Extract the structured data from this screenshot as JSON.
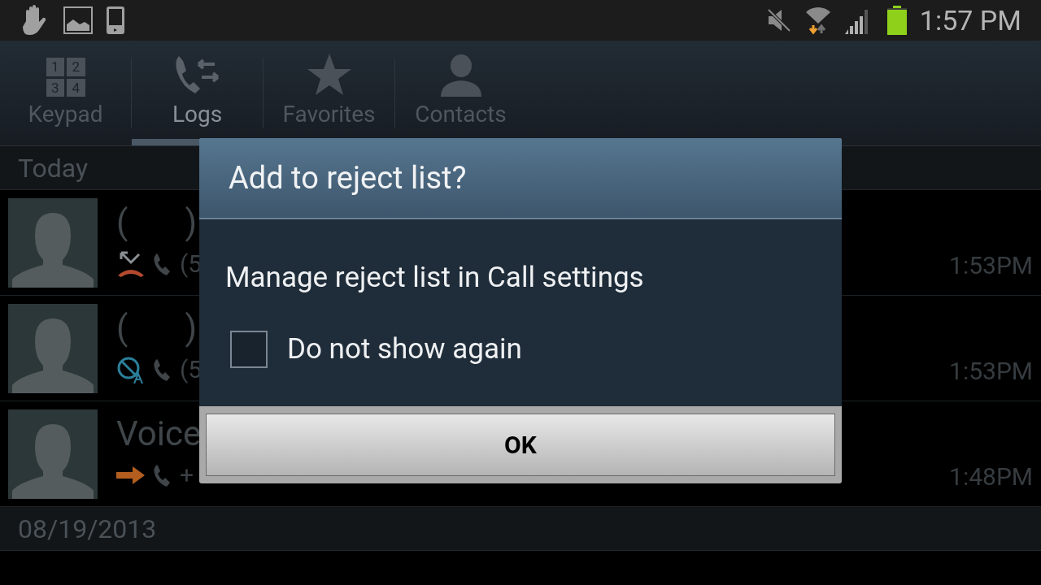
{
  "status_bar": {
    "time": "1:57 PM",
    "battery": {
      "level": 0.95
    }
  },
  "tabs": [
    {
      "label": "Keypad",
      "kind": "keypad",
      "selected": false,
      "keys": [
        "1",
        "2",
        "3",
        "4"
      ]
    },
    {
      "label": "Logs",
      "kind": "logs",
      "selected": true
    },
    {
      "label": "Favorites",
      "kind": "star",
      "selected": false
    },
    {
      "label": "Contacts",
      "kind": "person",
      "selected": false
    }
  ],
  "sections": [
    {
      "header": "Today",
      "rows": [
        {
          "name_open": "(",
          "name_close": ")",
          "kind": "rejected",
          "number": "(5",
          "time": "1:53PM"
        },
        {
          "name_open": "(",
          "name_close": ")",
          "kind": "auto_rejected",
          "number": "(5",
          "time": "1:53PM"
        },
        {
          "name": "Voice",
          "kind": "outgoing",
          "number": "+",
          "time": "1:48PM"
        }
      ]
    },
    {
      "header": "08/19/2013"
    }
  ],
  "dialog": {
    "title": "Add to reject list?",
    "message": "Manage reject list in Call settings",
    "checkbox": {
      "label": "Do not show again",
      "checked": false
    },
    "button": "OK"
  }
}
